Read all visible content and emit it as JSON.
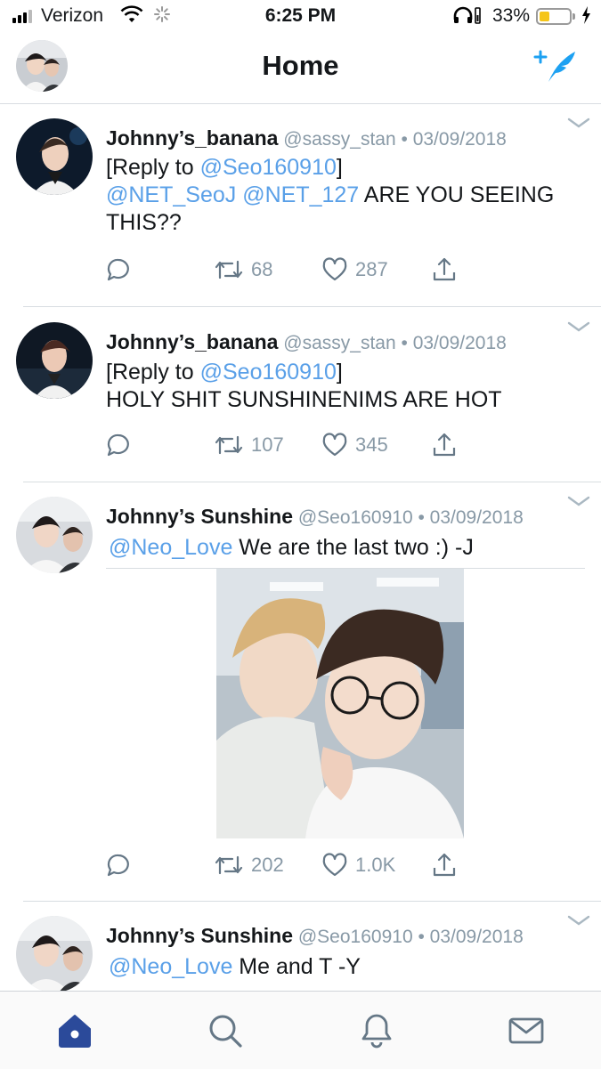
{
  "status_bar": {
    "carrier": "Verizon",
    "time": "6:25 PM",
    "battery_percent": "33%",
    "battery_level": 0.33,
    "icons": [
      "signal-icon",
      "wifi-icon",
      "loading-spinner-icon",
      "headphones-icon",
      "battery-icon",
      "charging-bolt-icon"
    ]
  },
  "header": {
    "title": "Home",
    "compose_icon": "compose-tweet-icon"
  },
  "colors": {
    "accent": "#1da1f2",
    "mention": "#5aa0e8",
    "muted": "#8899a6",
    "active_tab": "#2b4a9a"
  },
  "tweets": [
    {
      "display_name": "Johnny’s_banana",
      "handle": "@sassy_stan",
      "separator": "•",
      "date": "03/09/2018",
      "reply_prefix": "[Reply to ",
      "reply_to": "@Seo160910",
      "reply_suffix": "]",
      "mention_1": "@NET_SeoJ",
      "mention_2": "@NET_127",
      "text": " ARE YOU SEEING THIS??",
      "retweets": "68",
      "likes": "287"
    },
    {
      "display_name": "Johnny’s_banana",
      "handle": "@sassy_stan",
      "separator": "•",
      "date": "03/09/2018",
      "reply_prefix": "[Reply to ",
      "reply_to": "@Seo160910",
      "reply_suffix": "]",
      "text": "HOLY SHIT SUNSHINENIMS ARE HOT",
      "retweets": "107",
      "likes": "345"
    },
    {
      "display_name": "Johnny’s Sunshine",
      "handle": "@Seo160910",
      "separator": "•",
      "date": "03/09/2018",
      "mention": "@Neo_Love",
      "text": " We are the last two :) -J",
      "has_photo": true,
      "retweets": "202",
      "likes": "1.0K"
    },
    {
      "display_name": "Johnny’s Sunshine",
      "handle": "@Seo160910",
      "separator": "•",
      "date": "03/09/2018",
      "mention": "@Neo_Love",
      "text": " Me and T -Y"
    }
  ],
  "tab_bar": {
    "tabs": [
      {
        "name": "home",
        "icon": "home-icon",
        "active": true
      },
      {
        "name": "search",
        "icon": "search-icon",
        "active": false
      },
      {
        "name": "notifications",
        "icon": "bell-icon",
        "active": false
      },
      {
        "name": "messages",
        "icon": "mail-icon",
        "active": false
      }
    ]
  }
}
